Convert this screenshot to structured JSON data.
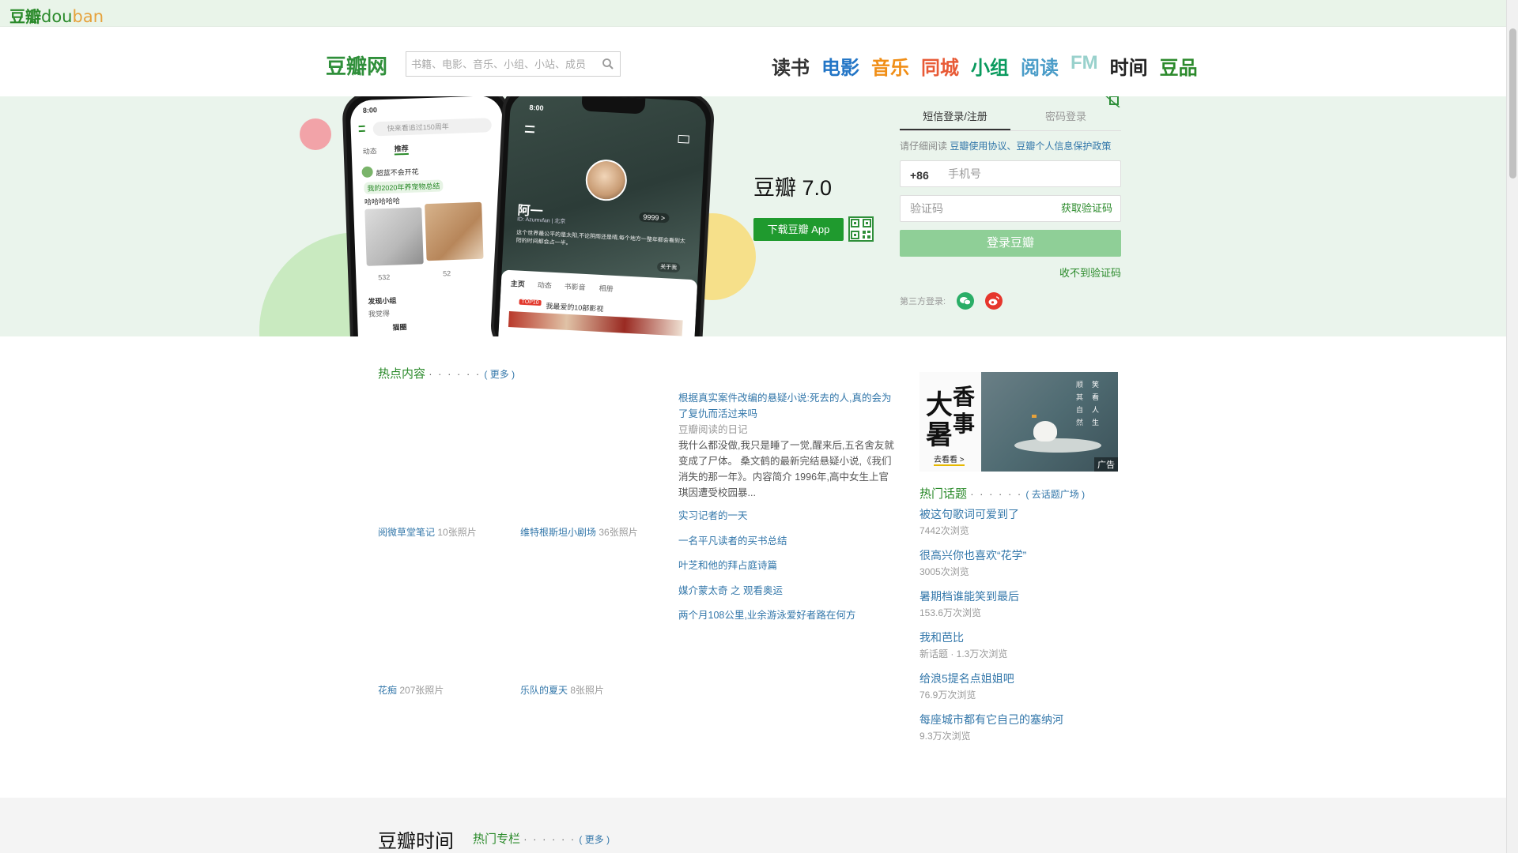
{
  "topbar": {
    "logo_cn": "豆瓣",
    "logo_latin_1": "dou",
    "logo_latin_2": "ban"
  },
  "header": {
    "site_title": "豆瓣网",
    "search_placeholder": "书籍、电影、音乐、小组、小站、成员",
    "nav": [
      {
        "label": "读书",
        "color": "#333333"
      },
      {
        "label": "电影",
        "color": "#2275c6"
      },
      {
        "label": "音乐",
        "color": "#f08e16"
      },
      {
        "label": "同城",
        "color": "#e85a36"
      },
      {
        "label": "小组",
        "color": "#0a9a5e"
      },
      {
        "label": "阅读",
        "color": "#4a9cc8"
      },
      {
        "label": "FM",
        "color": "#99d1cc"
      },
      {
        "label": "时间",
        "color": "#222222"
      },
      {
        "label": "豆品",
        "color": "#2c8a2c"
      }
    ]
  },
  "hero": {
    "app_title": "豆瓣 7.0",
    "download_label": "下载豆瓣 App",
    "phone_a": {
      "time": "8:00",
      "search": "快来看追过150周年",
      "tab1": "动态",
      "tab2": "推荐",
      "user": "超蓝不会开花",
      "badge": "我的2020年养宠物总结",
      "caption": "哈哈哈哈哈",
      "likes": "532",
      "comments": "52",
      "group": "发现小组",
      "group_sub": "我觉得",
      "group_tag": "猫圈"
    },
    "phone_b": {
      "time": "8:00",
      "name": "阿一",
      "id_line": "ID: Azumvfan | 北京",
      "coins": "9999 >",
      "bio": "这个世界最公平的是太阳,不论阴雨还是晴,每个地方一整年都会看到太阳的时间都会占一半。",
      "follow": "关于我",
      "tab1": "主页",
      "tab2": "动态",
      "tab3": "书影音",
      "tab4": "相册",
      "top10_badge": "TOP10",
      "top10_text": "我最爱的10部影视"
    }
  },
  "login": {
    "tab_sms": "短信登录/注册",
    "tab_pwd": "密码登录",
    "agree_prefix": "请仔细阅读",
    "agree_links": "豆瓣使用协议、豆瓣个人信息保护政策",
    "country_code": "+86",
    "phone_placeholder": "手机号",
    "code_placeholder": "验证码",
    "get_code": "获取验证码",
    "login_button": "登录豆瓣",
    "no_code": "收不到验证码",
    "third_party": "第三方登录:"
  },
  "hot": {
    "title": "热点内容",
    "dots": "· · · · · ·",
    "more": "更多",
    "albums": [
      {
        "title": "阅微草堂笔记",
        "count": "10张照片"
      },
      {
        "title": "维特根斯坦小剧场",
        "count": "36张照片"
      },
      {
        "title": "花痴",
        "count": "207张照片"
      },
      {
        "title": "乐队的夏天",
        "count": "8张照片"
      }
    ],
    "article": {
      "title": "根据真实案件改编的悬疑小说:死去的人,真的会为了复仇而活过来吗",
      "source": "豆瓣阅读的日记",
      "body": "我什么都没做,我只是睡了一觉,醒来后,五名舍友就变成了尸体。 桑文鹤的最新完结悬疑小说,《我们消失的那一年》。内容简介 1996年,高中女生上官琪因遭受校园暴..."
    },
    "links": [
      "实习记者的一天",
      "一名平凡读者的买书总结",
      "叶芝和他的拜占庭诗篇",
      "媒介蒙太奇 之 观看奥运",
      "两个月108公里,业余游泳爱好者路在何方"
    ]
  },
  "ad": {
    "big1": "大",
    "big2": "暑",
    "quote_top": "香",
    "quote_bot": "事",
    "cta": "去看看 >",
    "tag": "广告",
    "vertical": [
      "顺",
      "其",
      "自",
      "然",
      "笑",
      "看",
      "人",
      "生"
    ]
  },
  "topics": {
    "title": "热门话题",
    "dots": "· · · · · ·",
    "more": "去话题广场",
    "items": [
      {
        "title": "被这句歌词可爱到了",
        "meta": "7442次浏览"
      },
      {
        "title": "很高兴你也喜欢“花学”",
        "meta": "3005次浏览"
      },
      {
        "title": "暑期档谁能笑到最后",
        "meta": "153.6万次浏览"
      },
      {
        "title": "我和芭比",
        "meta": "新话题 · 1.3万次浏览"
      },
      {
        "title": "给浪5提名点姐姐吧",
        "meta": "76.9万次浏览"
      },
      {
        "title": "每座城市都有它自己的塞纳河",
        "meta": "9.3万次浏览"
      }
    ]
  },
  "bottom": {
    "title": "豆瓣时间",
    "col_title": "热门专栏",
    "dots": "· · · · · ·",
    "more": "更多"
  }
}
